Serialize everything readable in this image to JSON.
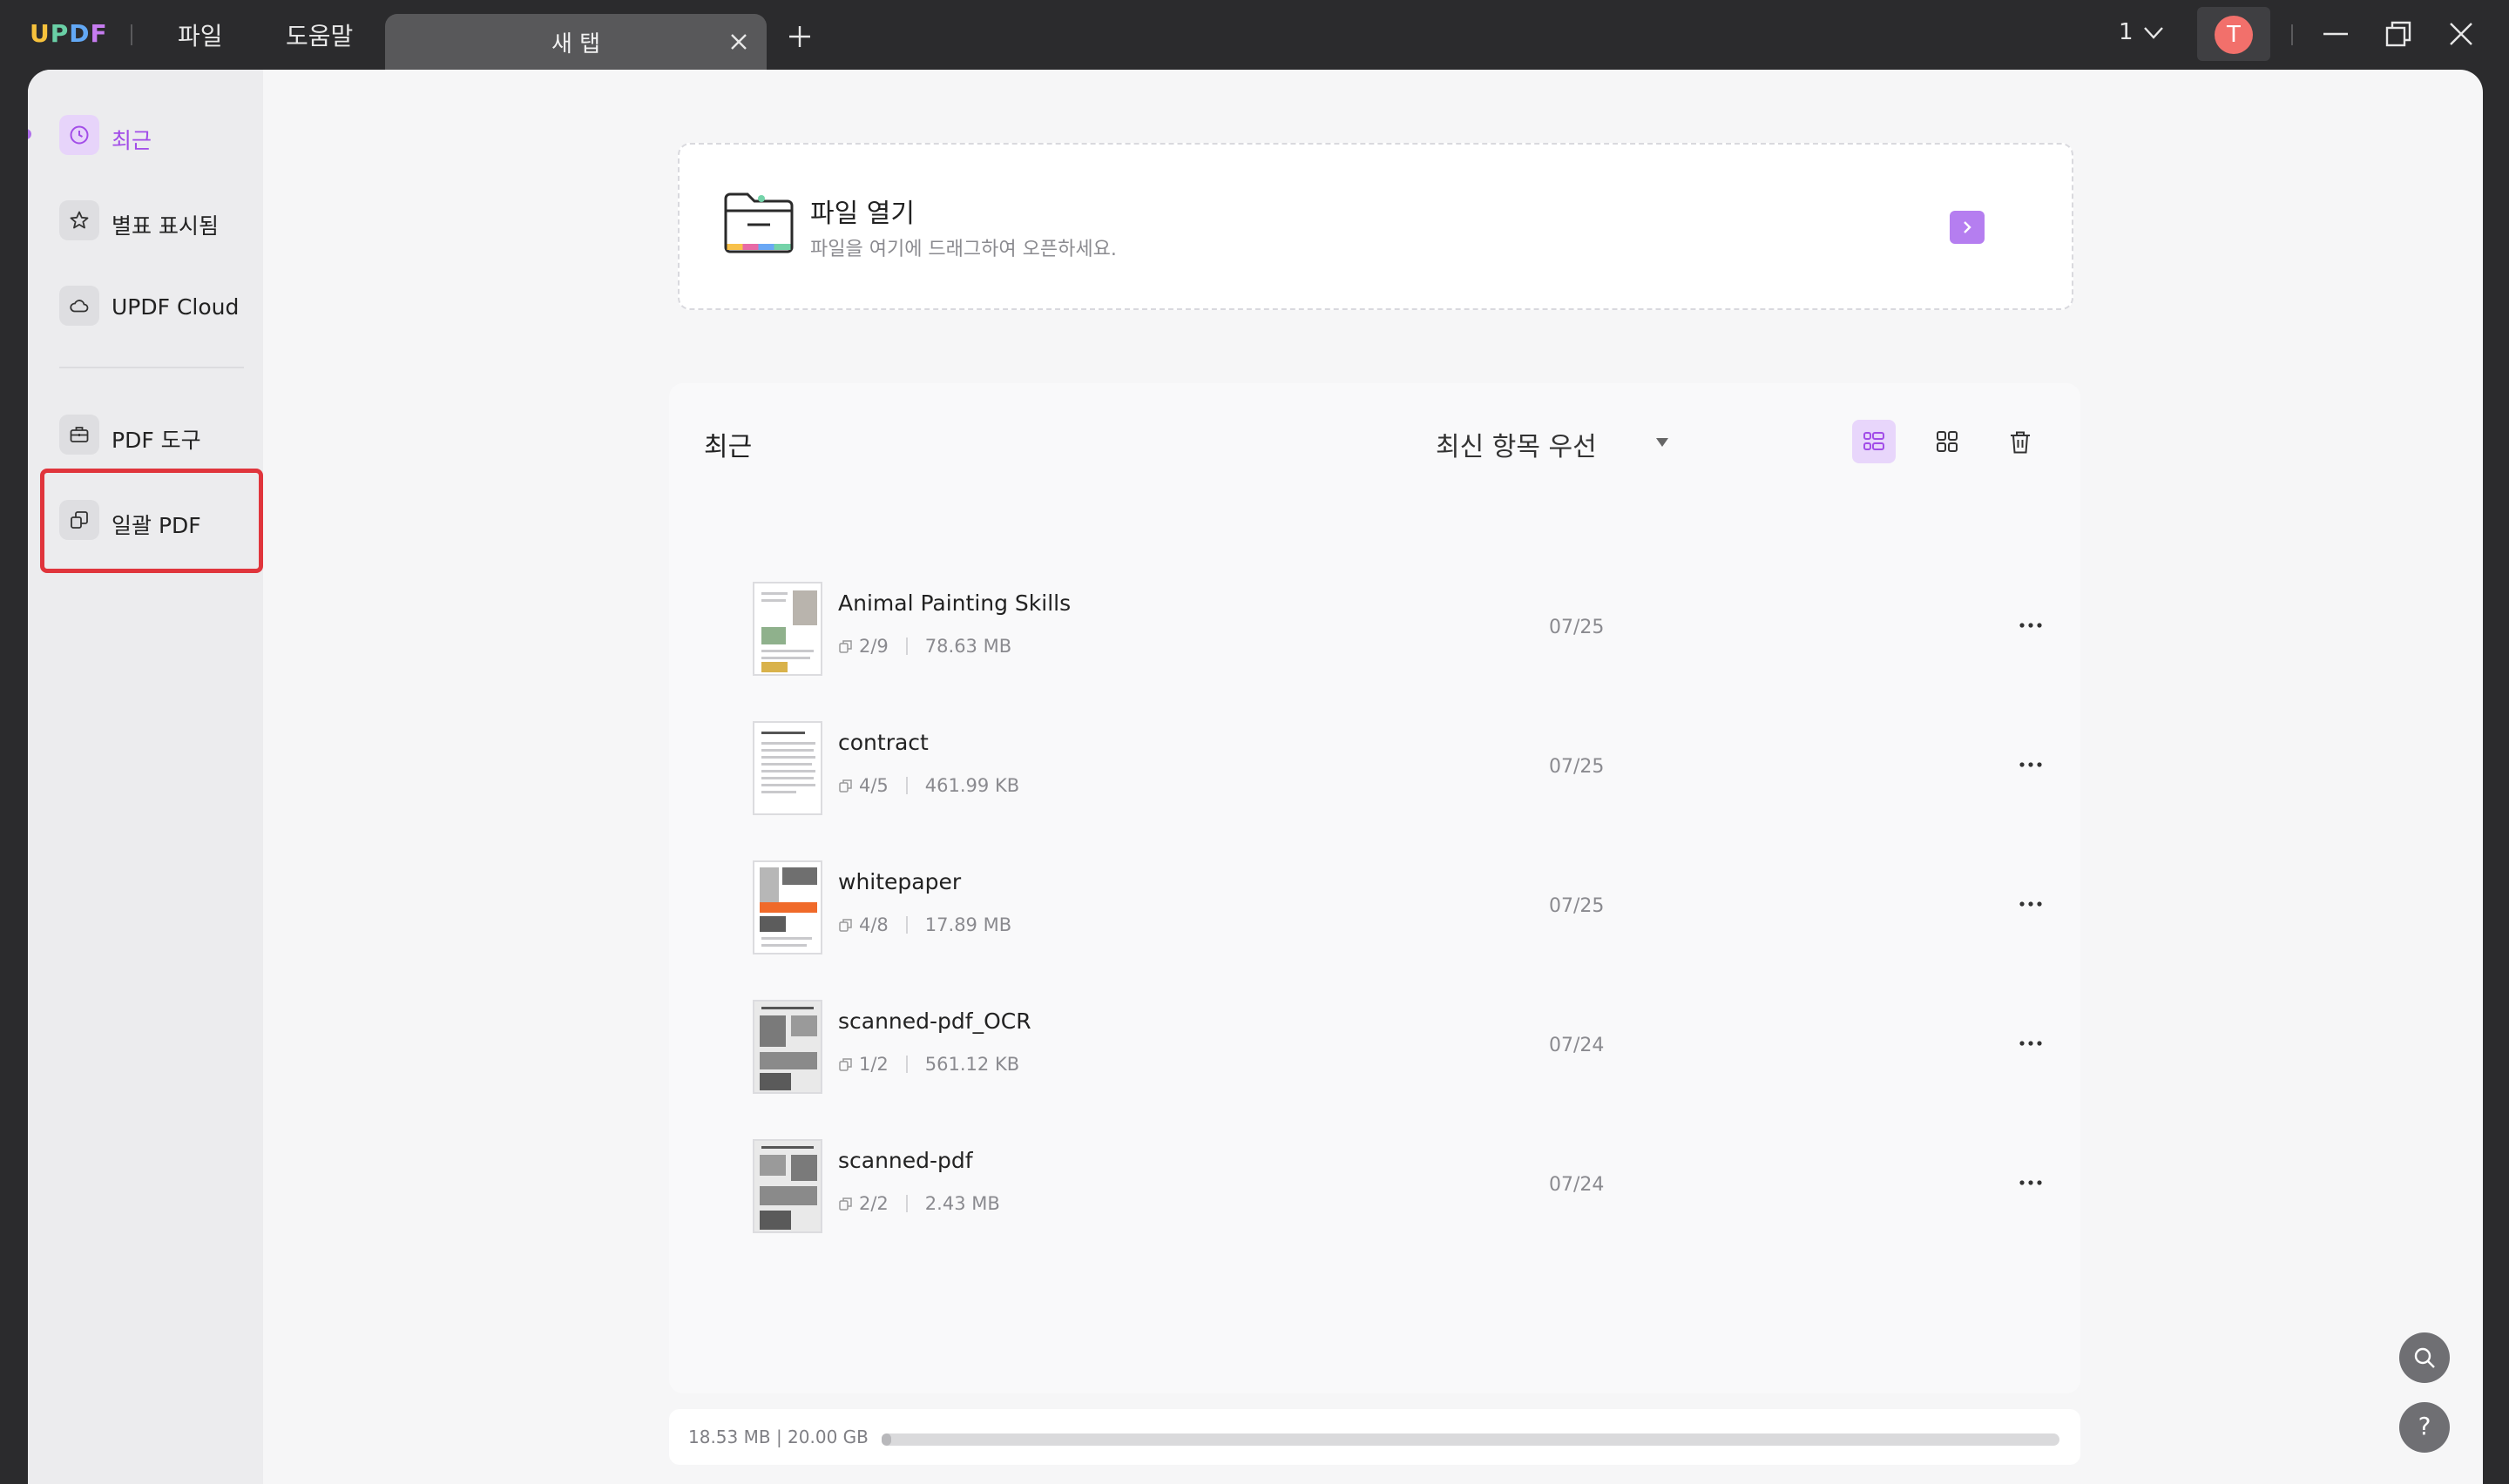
{
  "app": {
    "logo": "UPDF",
    "menu": {
      "file": "파일",
      "help": "도움말"
    },
    "tab": {
      "label": "새 탭"
    },
    "page_count": "1",
    "user_initial": "T"
  },
  "sidebar": {
    "items": [
      {
        "label": "최근",
        "icon": "clock-icon",
        "active": true
      },
      {
        "label": "별표 표시됨",
        "icon": "star-icon"
      },
      {
        "label": "UPDF Cloud",
        "icon": "cloud-icon"
      },
      {
        "label": "PDF 도구",
        "icon": "toolbox-icon"
      },
      {
        "label": "일괄 PDF",
        "icon": "batch-icon"
      }
    ]
  },
  "open_file": {
    "title": "파일 열기",
    "subtitle": "파일을 여기에 드래그하여 오픈하세요."
  },
  "recent": {
    "title": "최근",
    "sort_label": "최신 항목 우선",
    "files": [
      {
        "name": "Animal Painting Skills",
        "pages": "2/9",
        "size": "78.63 MB",
        "date": "07/25"
      },
      {
        "name": "contract",
        "pages": "4/5",
        "size": "461.99 KB",
        "date": "07/25"
      },
      {
        "name": "whitepaper",
        "pages": "4/8",
        "size": "17.89 MB",
        "date": "07/25"
      },
      {
        "name": "scanned-pdf_OCR",
        "pages": "1/2",
        "size": "561.12 KB",
        "date": "07/24"
      },
      {
        "name": "scanned-pdf",
        "pages": "2/2",
        "size": "2.43 MB",
        "date": "07/24"
      }
    ]
  },
  "storage": {
    "text": "18.53  MB | 20.00  GB",
    "used_fraction": 0.001
  },
  "colors": {
    "accent": "#a24de8",
    "highlight": "#e0353c"
  }
}
